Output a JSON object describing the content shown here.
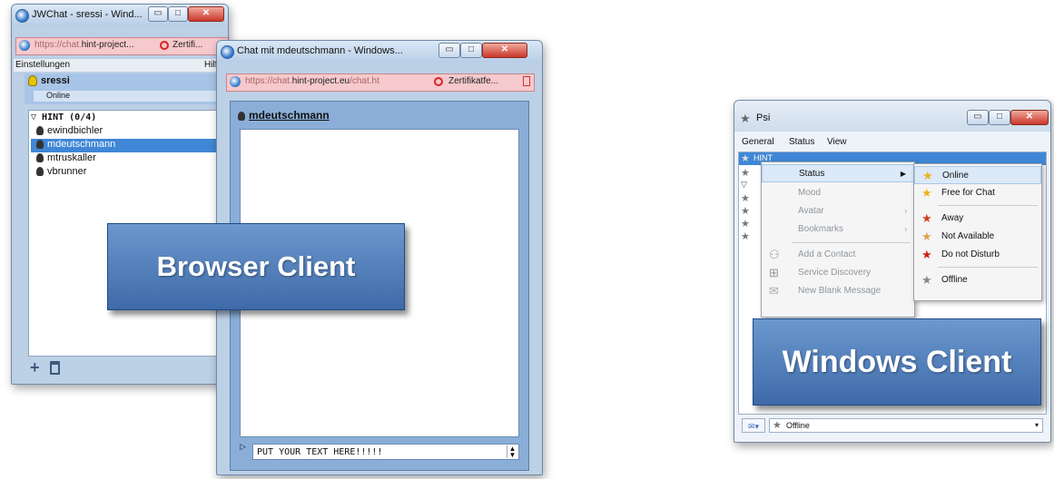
{
  "jwchat": {
    "title": "JWChat - sressi - Wind...",
    "url": {
      "prefix": "https://chat.",
      "host": "hint-project...",
      "cert": "Zertifi..."
    },
    "menu_left": "Einstellungen",
    "menu_right": "Hilf",
    "user": {
      "name": "sressi",
      "status": "Online"
    },
    "group": "HINT (0/4)",
    "contacts": [
      "ewindbichler",
      "mdeutschmann",
      "mtruskaller",
      "vbrunner"
    ],
    "add_icon": "plus-icon",
    "trash_icon": "trash-icon"
  },
  "chatwin": {
    "title": "Chat mit mdeutschmann - Windows...",
    "url": {
      "prefix": "https://chat.",
      "host": "hint-project.eu",
      "suffix": "/chat.ht",
      "cert": "Zertifikatfe..."
    },
    "contact": "mdeutschmann",
    "input_text": "PUT YOUR TEXT HERE!!!!!"
  },
  "psi": {
    "title": "Psi",
    "menubar": [
      "General",
      "Status",
      "View"
    ],
    "roster_head": "HINT",
    "context_menu": [
      {
        "label": "Status",
        "enabled": true,
        "submenu": true
      },
      {
        "label": "Mood",
        "enabled": false,
        "submenu": false
      },
      {
        "label": "Avatar",
        "enabled": false,
        "submenu": true
      },
      {
        "label": "Bookmarks",
        "enabled": false,
        "submenu": true
      },
      {
        "label": "Add a Contact",
        "enabled": false,
        "submenu": false
      },
      {
        "label": "Service Discovery",
        "enabled": false,
        "submenu": false
      },
      {
        "label": "New Blank Message",
        "enabled": false,
        "submenu": false
      }
    ],
    "status_menu": [
      "Online",
      "Free for Chat",
      "Away",
      "Not Available",
      "Do not Disturb",
      "Offline"
    ],
    "status_select": "Offline"
  },
  "labels": {
    "browser": "Browser Client",
    "windows": "Windows Client"
  },
  "colors": {
    "accent": "#3f87d6",
    "label_box": "#4f7dbd",
    "online_star": "#f0b020",
    "away": "#d0401e"
  }
}
